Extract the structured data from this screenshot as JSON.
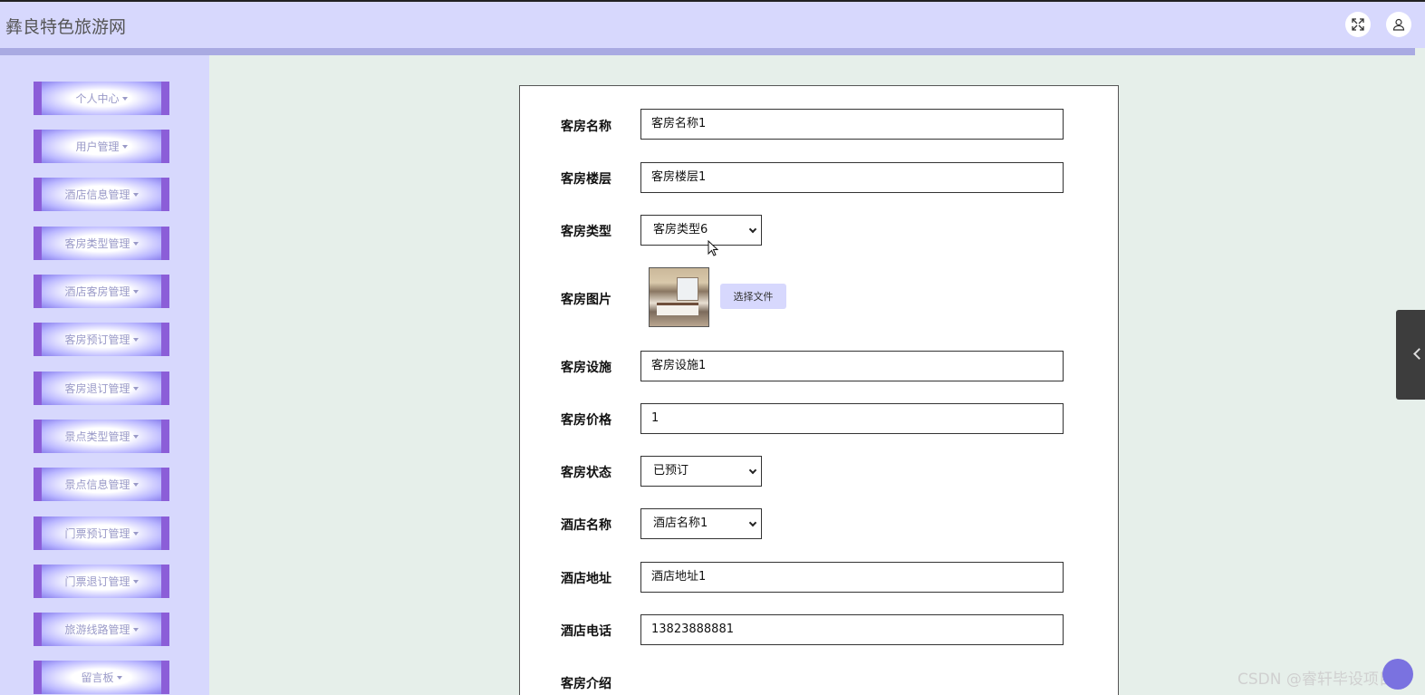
{
  "app": {
    "title": "彝良特色旅游网"
  },
  "topbar_icons": {
    "fullscreen": "expand-icon",
    "user": "user-icon"
  },
  "sidebar": {
    "items": [
      {
        "label": "个人中心"
      },
      {
        "label": "用户管理"
      },
      {
        "label": "酒店信息管理"
      },
      {
        "label": "客房类型管理"
      },
      {
        "label": "酒店客房管理"
      },
      {
        "label": "客房预订管理"
      },
      {
        "label": "客房退订管理"
      },
      {
        "label": "景点类型管理"
      },
      {
        "label": "景点信息管理"
      },
      {
        "label": "门票预订管理"
      },
      {
        "label": "门票退订管理"
      },
      {
        "label": "旅游线路管理"
      },
      {
        "label": "留言板"
      }
    ]
  },
  "form": {
    "room_name": {
      "label": "客房名称",
      "value": "客房名称1"
    },
    "room_floor": {
      "label": "客房楼层",
      "value": "客房楼层1"
    },
    "room_type": {
      "label": "客房类型",
      "value": "客房类型6"
    },
    "room_image": {
      "label": "客房图片",
      "button": "选择文件"
    },
    "room_facility": {
      "label": "客房设施",
      "value": "客房设施1"
    },
    "room_price": {
      "label": "客房价格",
      "value": "1"
    },
    "room_status": {
      "label": "客房状态",
      "value": "已预订"
    },
    "hotel_name": {
      "label": "酒店名称",
      "value": "酒店名称1"
    },
    "hotel_address": {
      "label": "酒店地址",
      "value": "酒店地址1"
    },
    "hotel_phone": {
      "label": "酒店电话",
      "value": "13823888881"
    },
    "room_intro": {
      "label": "客房介绍"
    }
  },
  "watermark": "CSDN @睿轩毕设项目"
}
